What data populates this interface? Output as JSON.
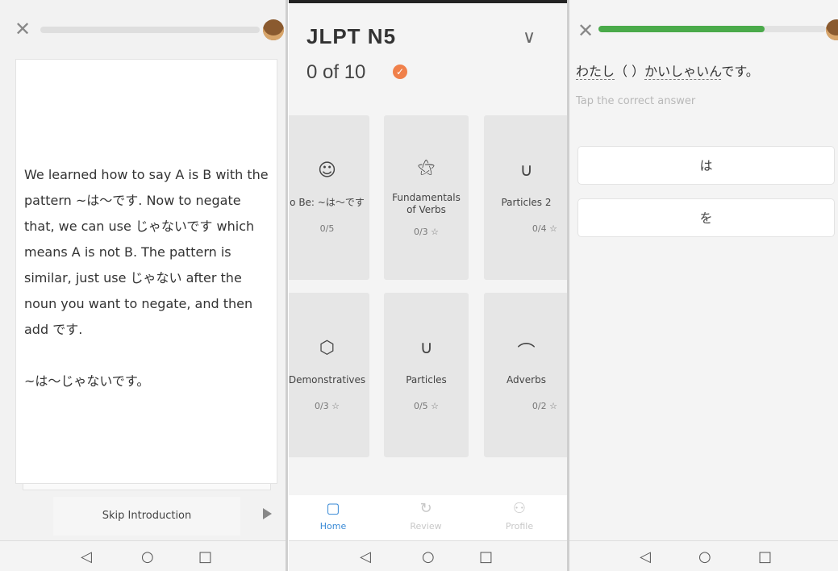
{
  "panel_intro": {
    "close_icon": "✕",
    "lesson_text": "We learned how to say A is B with the pattern ~は〜です. Now to negate that, we can use じゃないです which means A is not B. The pattern is similar, just use じゃない after the noun you want to negate, and then add です.\n\n~は〜じゃないです。",
    "skip_label": "Skip Introduction"
  },
  "panel_course": {
    "title": "JLPT N5",
    "progress_text": "0 of 10",
    "check_icon": "✓",
    "chevron_icon": "∨",
    "tiles": [
      {
        "icon": "☺",
        "name": "o Be: ~は〜です",
        "progress": "0/5",
        "star": ""
      },
      {
        "icon": "⚝",
        "name": "Fundamentals of Verbs",
        "progress": "0/3",
        "star": "☆"
      },
      {
        "icon": "∪",
        "name": "Particles 2",
        "progress": "0/4",
        "star": "☆"
      },
      {
        "icon": "⬡",
        "name": "Demonstratives",
        "progress": "0/3",
        "star": "☆"
      },
      {
        "icon": "∪",
        "name": "Particles",
        "progress": "0/5",
        "star": "☆"
      },
      {
        "icon": "⌒",
        "name": "Adverbs",
        "progress": "0/2",
        "star": "☆"
      }
    ],
    "nav": [
      {
        "icon": "▢",
        "label": "Home",
        "color": "#3a8ad6"
      },
      {
        "icon": "↻",
        "label": "Review",
        "color": "#c8c8c8"
      },
      {
        "icon": "⚇",
        "label": "Profile",
        "color": "#c8c8c8"
      }
    ]
  },
  "panel_quiz": {
    "close_icon": "✕",
    "progress": 0.73,
    "question_a": "わたし",
    "question_blank": "（ ）",
    "question_b": "かいしゃいん",
    "question_end": "です。",
    "hint": "Tap the correct answer",
    "answers": [
      "は",
      "を"
    ]
  },
  "system_nav": {
    "back": "◁",
    "home": "○",
    "recent": "□"
  }
}
